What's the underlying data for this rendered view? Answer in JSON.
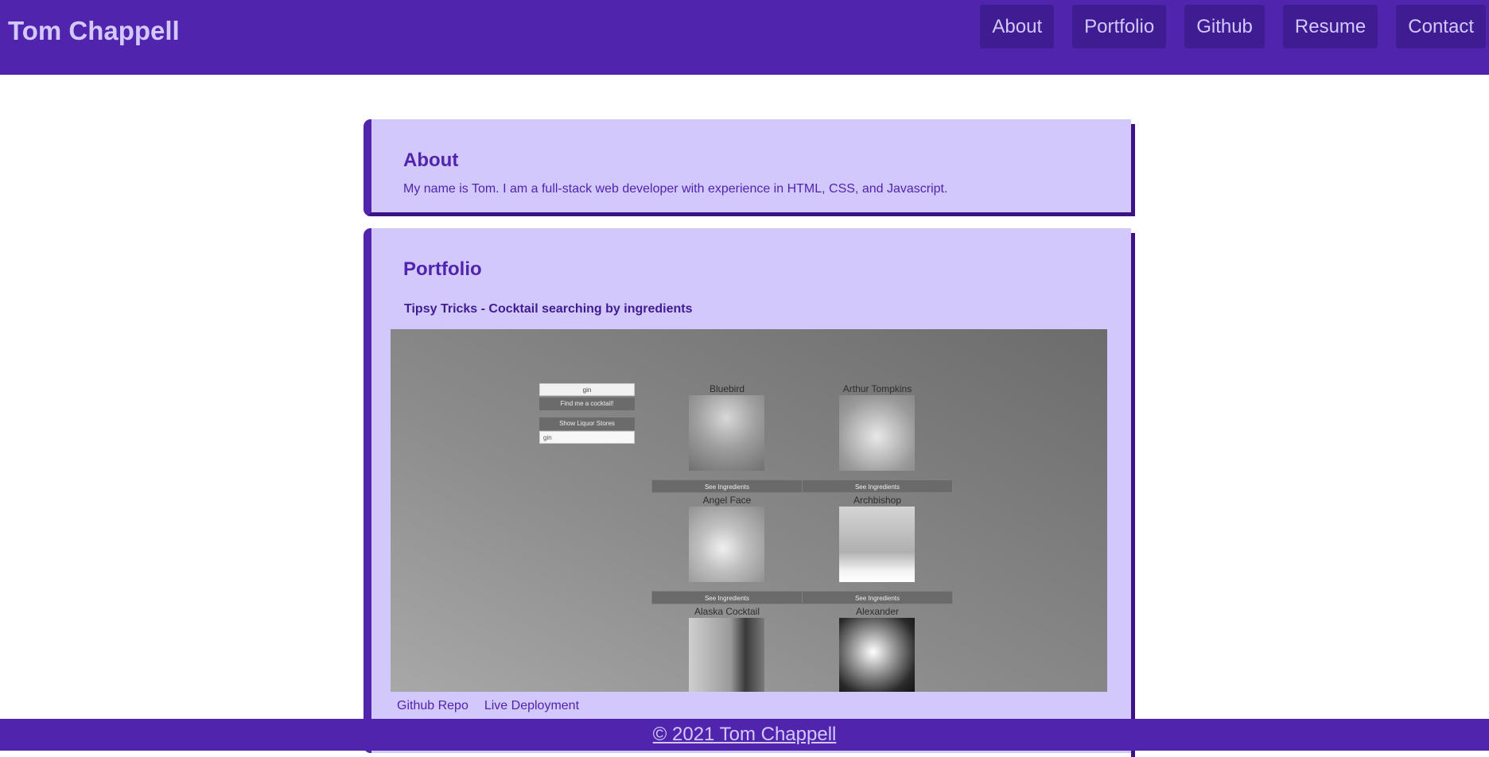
{
  "header": {
    "site_title": "Tom Chappell",
    "nav": [
      "About",
      "Portfolio",
      "Github",
      "Resume",
      "Contact"
    ]
  },
  "about": {
    "heading": "About",
    "text": "My name is Tom. I am a full-stack web developer with experience in HTML, CSS, and Javascript."
  },
  "portfolio": {
    "heading": "Portfolio",
    "project_title": "Tipsy Tricks - Cocktail searching by ingredients",
    "preview": {
      "search_value": "gin",
      "find_button": "Find me a cocktail!",
      "liquor_button": "Show Liquor Stores",
      "location_value": "gin",
      "see_label": "See Ingredients",
      "drinks": [
        "Bluebird",
        "Arthur Tompkins",
        "Angel Face",
        "Archbishop",
        "Alaska Cocktail",
        "Alexander"
      ]
    },
    "links": {
      "repo": "Github Repo",
      "live": "Live Deployment"
    }
  },
  "footer": {
    "text": "© 2021 Tom Chappell"
  },
  "colors": {
    "primary": "#5024ad",
    "card": "#d3c8fb",
    "nav_button": "#3f1c92"
  }
}
